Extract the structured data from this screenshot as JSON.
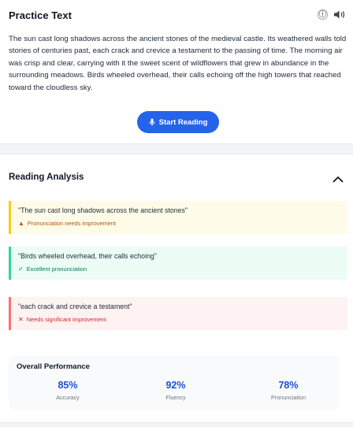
{
  "practice": {
    "title": "Practice Text",
    "info_icon": "ⓘ",
    "passage": "The sun cast long shadows across the ancient stones of the medieval castle. Its weathered walls told stories of centuries past, each crack and crevice a testament to the passing of time. The morning air was crisp and clear, carrying with it the sweet scent of wildflowers that grew in abundance in the surrounding meadows. Birds wheeled overhead, their calls echoing off the high towers that reached toward the cloudless sky.",
    "start_button_label": "Start Reading"
  },
  "analysis": {
    "title": "Reading Analysis",
    "items": [
      {
        "quote": "\"The sun cast long shadows across the ancient stones\"",
        "status_icon": "▲",
        "status": "Pronunciation needs improvement"
      },
      {
        "quote": "\"Birds wheeled overhead, their calls echoing\"",
        "status_icon": "✓",
        "status": "Excellent pronunciation"
      },
      {
        "quote": "\"each crack and crevice a testament\"",
        "status_icon": "✕",
        "status": "Needs significant improvement"
      }
    ],
    "overall": {
      "title": "Overall Performance",
      "metrics": [
        {
          "value": "85%",
          "label": "Accuracy"
        },
        {
          "value": "92%",
          "label": "Fluency"
        },
        {
          "value": "78%",
          "label": "Pronunciation"
        }
      ]
    }
  },
  "colors": {
    "primary": "#2563eb",
    "warning": "#facc15",
    "success": "#34d399",
    "danger": "#f87171"
  }
}
